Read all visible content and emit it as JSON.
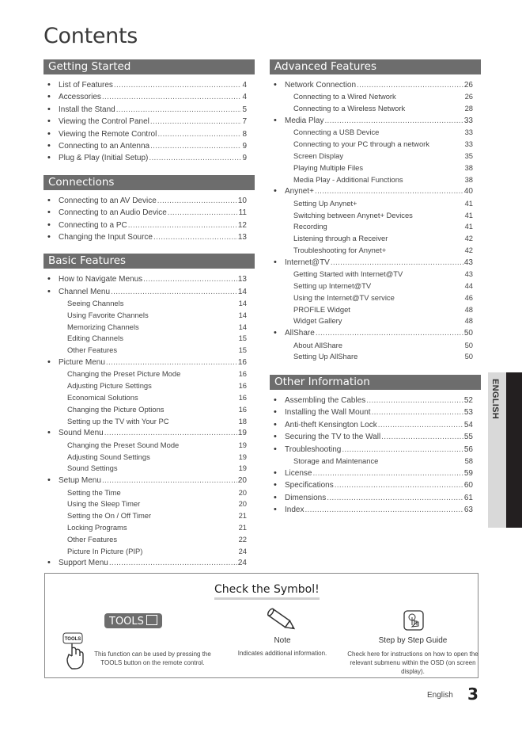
{
  "page_title": "Contents",
  "left_column": [
    {
      "heading": "Getting Started",
      "entries": [
        {
          "type": "main",
          "label": "List of Features",
          "page": "4"
        },
        {
          "type": "main",
          "label": "Accessories",
          "page": "4"
        },
        {
          "type": "main",
          "label": "Install the Stand",
          "page": "5"
        },
        {
          "type": "main",
          "label": "Viewing the Control Panel",
          "page": "7"
        },
        {
          "type": "main",
          "label": "Viewing the Remote Control",
          "page": "8"
        },
        {
          "type": "main",
          "label": "Connecting to an Antenna",
          "page": "9"
        },
        {
          "type": "main",
          "label": "Plug & Play (Initial Setup)",
          "page": "9"
        }
      ]
    },
    {
      "heading": "Connections",
      "entries": [
        {
          "type": "main",
          "label": "Connecting to an AV Device",
          "page": "10"
        },
        {
          "type": "main",
          "label": "Connecting to an Audio Device",
          "page": "11"
        },
        {
          "type": "main",
          "label": "Connecting to a PC",
          "page": "12"
        },
        {
          "type": "main",
          "label": "Changing the Input Source",
          "page": "13"
        }
      ]
    },
    {
      "heading": "Basic Features",
      "entries": [
        {
          "type": "main",
          "label": "How to Navigate Menus",
          "page": "13"
        },
        {
          "type": "main",
          "label": "Channel Menu",
          "page": "14"
        },
        {
          "type": "sub",
          "label": "Seeing Channels",
          "page": "14"
        },
        {
          "type": "sub",
          "label": "Using Favorite Channels",
          "page": "14"
        },
        {
          "type": "sub",
          "label": "Memorizing Channels",
          "page": "14"
        },
        {
          "type": "sub",
          "label": "Editing Channels",
          "page": "15"
        },
        {
          "type": "sub",
          "label": "Other Features",
          "page": "15"
        },
        {
          "type": "main",
          "label": "Picture Menu",
          "page": "16"
        },
        {
          "type": "sub",
          "label": "Changing the Preset Picture Mode",
          "page": "16"
        },
        {
          "type": "sub",
          "label": "Adjusting Picture Settings",
          "page": "16"
        },
        {
          "type": "sub",
          "label": "Economical Solutions",
          "page": "16"
        },
        {
          "type": "sub",
          "label": "Changing the Picture Options",
          "page": "16"
        },
        {
          "type": "sub",
          "label": "Setting up the TV with Your PC",
          "page": "18"
        },
        {
          "type": "main",
          "label": "Sound Menu",
          "page": "19"
        },
        {
          "type": "sub",
          "label": "Changing the Preset Sound Mode",
          "page": "19"
        },
        {
          "type": "sub",
          "label": "Adjusting Sound Settings",
          "page": "19"
        },
        {
          "type": "sub",
          "label": "Sound Settings",
          "page": "19"
        },
        {
          "type": "main",
          "label": "Setup Menu",
          "page": "20"
        },
        {
          "type": "sub",
          "label": "Setting the Time",
          "page": "20"
        },
        {
          "type": "sub",
          "label": "Using the Sleep Timer",
          "page": "20"
        },
        {
          "type": "sub",
          "label": "Setting the On / Off Timer",
          "page": "21"
        },
        {
          "type": "sub",
          "label": "Locking Programs",
          "page": "21"
        },
        {
          "type": "sub",
          "label": "Other Features",
          "page": "22"
        },
        {
          "type": "sub",
          "label": "Picture In Picture (PIP)",
          "page": "24"
        },
        {
          "type": "main",
          "label": "Support Menu",
          "page": "24"
        }
      ]
    }
  ],
  "right_column": [
    {
      "heading": "Advanced Features",
      "entries": [
        {
          "type": "main",
          "label": "Network Connection",
          "page": "26"
        },
        {
          "type": "sub",
          "label": "Connecting to a Wired Network",
          "page": "26"
        },
        {
          "type": "sub",
          "label": "Connecting to a Wireless Network",
          "page": "28"
        },
        {
          "type": "main",
          "label": "Media Play",
          "page": "33"
        },
        {
          "type": "sub",
          "label": "Connecting a USB Device",
          "page": "33"
        },
        {
          "type": "sub",
          "label": "Connecting to your PC through a network",
          "page": "33"
        },
        {
          "type": "sub",
          "label": "Screen Display",
          "page": "35"
        },
        {
          "type": "sub",
          "label": "Playing Multiple Files",
          "page": "38"
        },
        {
          "type": "sub",
          "label": "Media Play - Additional Functions",
          "page": "38"
        },
        {
          "type": "main",
          "label": "Anynet+",
          "page": "40"
        },
        {
          "type": "sub",
          "label": "Setting Up Anynet+",
          "page": "41"
        },
        {
          "type": "sub",
          "label": "Switching between Anynet+ Devices",
          "page": "41"
        },
        {
          "type": "sub",
          "label": "Recording",
          "page": "41"
        },
        {
          "type": "sub",
          "label": "Listening through a Receiver",
          "page": "42"
        },
        {
          "type": "sub",
          "label": "Troubleshooting for Anynet+",
          "page": "42"
        },
        {
          "type": "main",
          "label": "Internet@TV",
          "page": "43"
        },
        {
          "type": "sub",
          "label": "Getting Started with Internet@TV",
          "page": "43"
        },
        {
          "type": "sub",
          "label": "Setting up Internet@TV",
          "page": "44"
        },
        {
          "type": "sub",
          "label": "Using the Internet@TV service",
          "page": "46"
        },
        {
          "type": "sub",
          "label": "PROFILE Widget",
          "page": "48"
        },
        {
          "type": "sub",
          "label": "Widget Gallery",
          "page": "48"
        },
        {
          "type": "main",
          "label": "AllShare",
          "page": "50"
        },
        {
          "type": "sub",
          "label": "About AllShare",
          "page": "50"
        },
        {
          "type": "sub",
          "label": "Setting Up AllShare",
          "page": "50"
        }
      ]
    },
    {
      "heading": "Other Information",
      "entries": [
        {
          "type": "main",
          "label": "Assembling the Cables",
          "page": "52"
        },
        {
          "type": "main",
          "label": "Installing the Wall Mount",
          "page": "53"
        },
        {
          "type": "main",
          "label": "Anti-theft Kensington Lock",
          "page": "54"
        },
        {
          "type": "main",
          "label": "Securing the TV to the Wall",
          "page": "55"
        },
        {
          "type": "main",
          "label": "Troubleshooting",
          "page": "56"
        },
        {
          "type": "sub",
          "label": "Storage and Maintenance",
          "page": "58"
        },
        {
          "type": "main",
          "label": "License",
          "page": "59"
        },
        {
          "type": "main",
          "label": "Specifications",
          "page": "60"
        },
        {
          "type": "main",
          "label": "Dimensions",
          "page": "61"
        },
        {
          "type": "main",
          "label": "Index",
          "page": "63"
        }
      ]
    }
  ],
  "language_tab": "ENGLISH",
  "symbol_box": {
    "title": "Check the Symbol!",
    "tools": {
      "badge_label": "TOOLS",
      "hand_button_label": "TOOLS",
      "description": "This function can be used by pressing the TOOLS button on the remote control."
    },
    "note": {
      "label": "Note",
      "description": "Indicates additional information."
    },
    "guide": {
      "label": "Step by Step Guide",
      "description": "Check here for instructions on how to open the relevant submenu within the OSD (on screen display)."
    }
  },
  "footer": {
    "language": "English",
    "page_number": "3"
  },
  "colors": {
    "section_header_bg": "#6d6d6d",
    "tab_light": "#d9d9d9",
    "tab_dark": "#231f20"
  }
}
